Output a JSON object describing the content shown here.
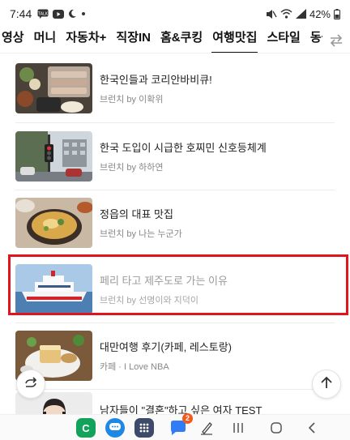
{
  "status_bar": {
    "time": "7:44",
    "battery": "42%",
    "left_icons": [
      "message-icon",
      "youtube-icon",
      "moon-icon",
      "dot-icon"
    ],
    "right_icons": [
      "mute-icon",
      "wifi-icon",
      "signal-icon",
      "battery-icon"
    ]
  },
  "tabs": {
    "items": [
      {
        "label": "영상"
      },
      {
        "label": "머니"
      },
      {
        "label": "자동차+"
      },
      {
        "label": "직장IN"
      },
      {
        "label": "홈&쿠킹"
      },
      {
        "label": "여행맛집",
        "active": true
      },
      {
        "label": "스타일"
      },
      {
        "label": "동물"
      }
    ],
    "swap_icon": "swap-arrows-icon"
  },
  "articles": [
    {
      "title": "한국인들과 코리안바비큐!",
      "meta": "브런치 by 이확위",
      "thumb": "bbq"
    },
    {
      "title": "한국 도입이 시급한 호찌민 신호등체계",
      "meta": "브런치 by 하하연",
      "thumb": "traffic"
    },
    {
      "title": "정읍의 대표 맛집",
      "meta": "브런치 by 나는 누군가",
      "thumb": "soup"
    },
    {
      "title": "페리 타고 제주도로 가는 이유",
      "meta": "브런치 by 선명이와 지덕이",
      "thumb": "ferry",
      "dim": true
    },
    {
      "title": "대만여행 후기(카페, 레스토랑)",
      "meta": "카페 · I Love NBA",
      "thumb": "cafe"
    },
    {
      "title": "남자들이 \"결혼\"하고 싶은 여자 TEST",
      "meta": "",
      "thumb": "person"
    }
  ],
  "nav": {
    "apps": [
      "phone-app-icon",
      "chat-app-icon",
      "apps-grid-icon",
      "messenger-app-icon",
      "pen-icon"
    ],
    "messenger_badge": "2",
    "system": [
      "recents-icon",
      "home-icon",
      "back-icon"
    ]
  },
  "colors": {
    "highlight": "#e0141c",
    "phone_app": "#12a25c",
    "chat_app": "#1e88e5",
    "apps_grid": "#3d4a6a",
    "messenger": "#2f7cf6",
    "badge": "#f25a1d"
  }
}
